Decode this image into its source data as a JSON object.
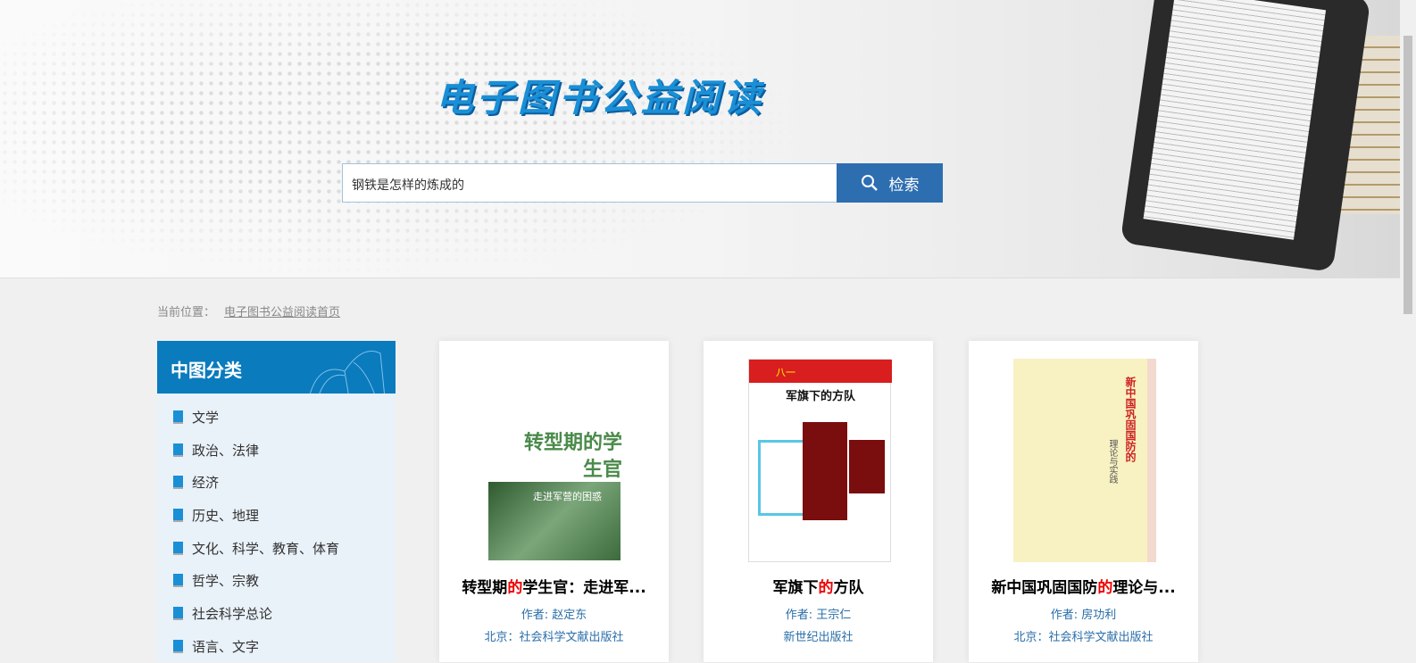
{
  "header": {
    "site_title": "电子图书公益阅读",
    "search_value": "钢铁是怎样的炼成的",
    "search_button": "检索"
  },
  "breadcrumb": {
    "label": "当前位置：",
    "home": "电子图书公益阅读首页"
  },
  "sidebar": {
    "title": "中图分类",
    "items": [
      "文学",
      "政治、法律",
      "经济",
      "历史、地理",
      "文化、科学、教育、体育",
      "哲学、宗教",
      "社会科学总论",
      "语言、文字"
    ]
  },
  "books": [
    {
      "title_pre": "转型期",
      "title_hl": "的",
      "title_post": "学生官：走进军...",
      "author": "作者: 赵定东",
      "publisher": "北京：社会科学文献出版社",
      "cover_text": "转型期的学生官",
      "cover_sub": "走进军营的困惑"
    },
    {
      "title_pre": "军旗下",
      "title_hl": "的",
      "title_post": "方队",
      "author": "作者: 王宗仁",
      "publisher": "新世纪出版社",
      "cover_text": "军旗下的方队",
      "cover_sub": "八一"
    },
    {
      "title_pre": "新中国巩固国防",
      "title_hl": "的",
      "title_post": "理论与...",
      "author": "作者: 房功利",
      "publisher": "北京：社会科学文献出版社",
      "cover_text": "新中国巩固国防的",
      "cover_sub": "理论与实践"
    }
  ],
  "colors": {
    "accent": "#0a7bbd",
    "button": "#2d6eb1",
    "highlight": "#e00000"
  }
}
